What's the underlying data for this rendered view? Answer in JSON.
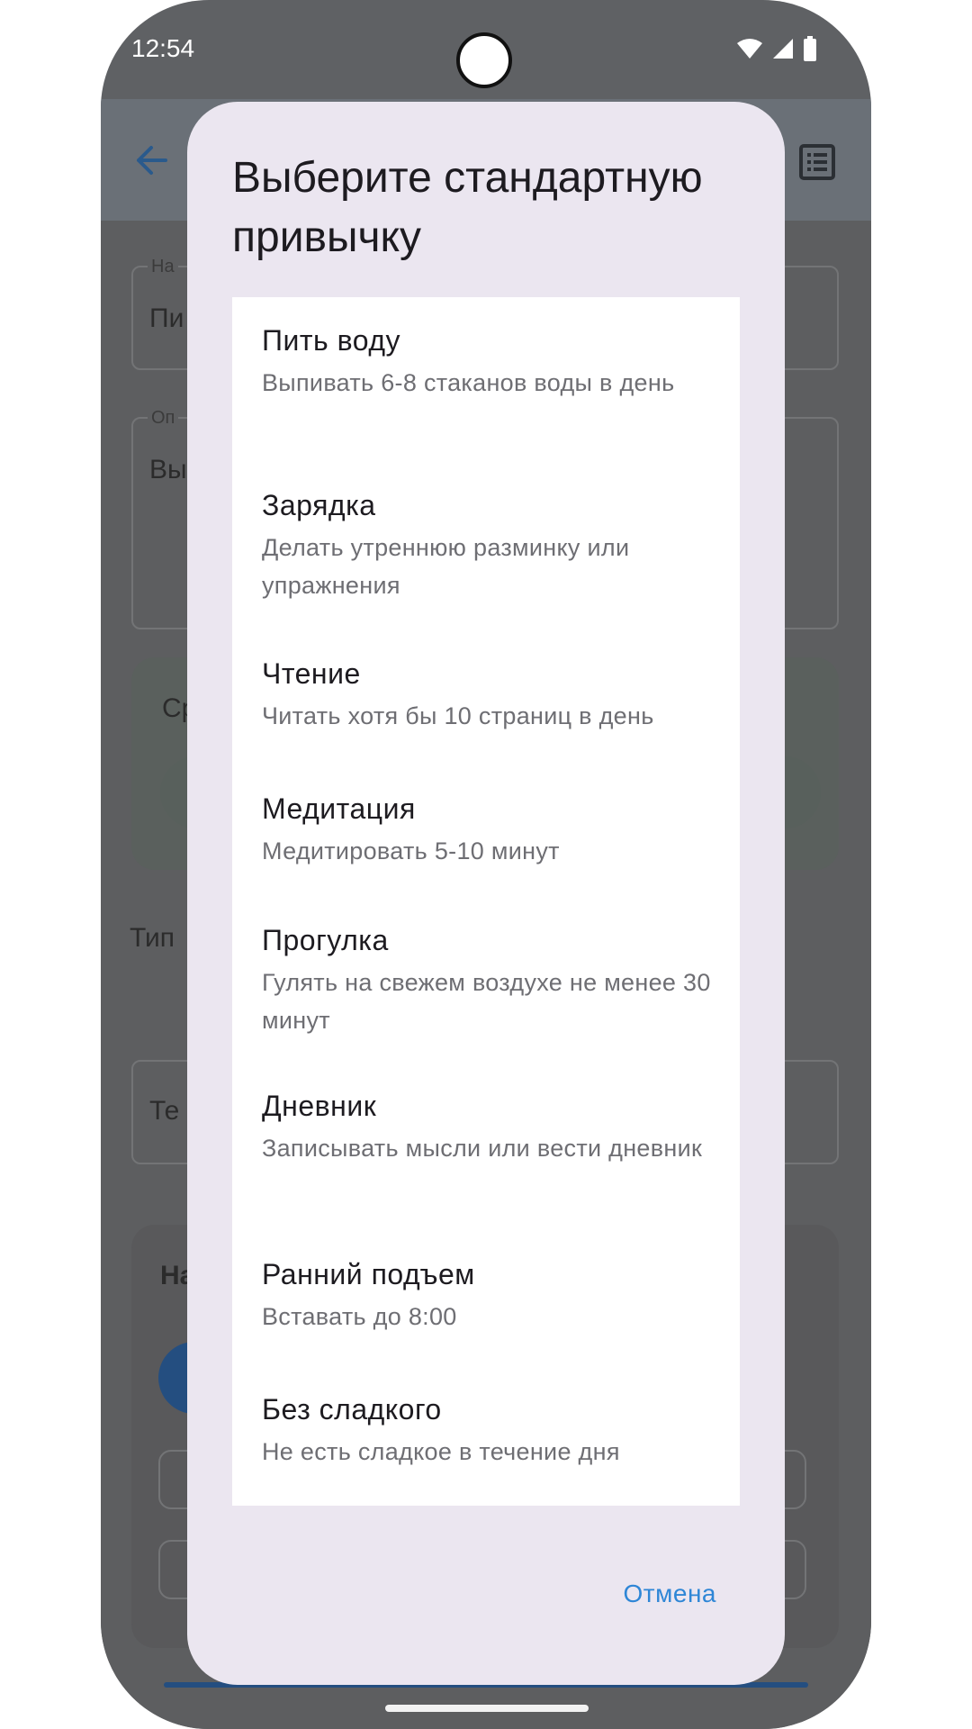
{
  "status_bar": {
    "time": "12:54",
    "icons": [
      "wifi-icon",
      "signal-icon",
      "battery-icon"
    ]
  },
  "background_screen": {
    "app_bar_icons": [
      "arrow-back-icon",
      "list-icon"
    ],
    "partial_labels": {
      "name_label": "На",
      "name_value": "Пи",
      "desc_label": "Оп",
      "desc_value": "Вы",
      "card_text": "Ср",
      "type_label": "Тип",
      "type_value": "Те",
      "card2_title": "На"
    }
  },
  "dialog": {
    "title": "Выберите стандартную привычку",
    "habits": [
      {
        "title": "Пить воду",
        "description": "Выпивать 6-8 стаканов воды в день"
      },
      {
        "title": "Зарядка",
        "description": "Делать утреннюю разминку или упражнения"
      },
      {
        "title": "Чтение",
        "description": "Читать хотя бы 10 страниц в день"
      },
      {
        "title": "Медитация",
        "description": "Медитировать 5-10 минут"
      },
      {
        "title": "Прогулка",
        "description": "Гулять на свежем воздухе не менее 30 минут"
      },
      {
        "title": "Дневник",
        "description": "Записывать мысли или вести дневник"
      },
      {
        "title": "Ранний подъем",
        "description": "Вставать до 8:00"
      },
      {
        "title": "Без сладкого",
        "description": "Не есть сладкое в течение дня"
      }
    ],
    "cancel_label": "Отмена"
  },
  "colors": {
    "dialog_background": "#ebe6f0",
    "list_background": "#ffffff",
    "accent": "#2e86d6",
    "scrim": "#5f6164"
  }
}
